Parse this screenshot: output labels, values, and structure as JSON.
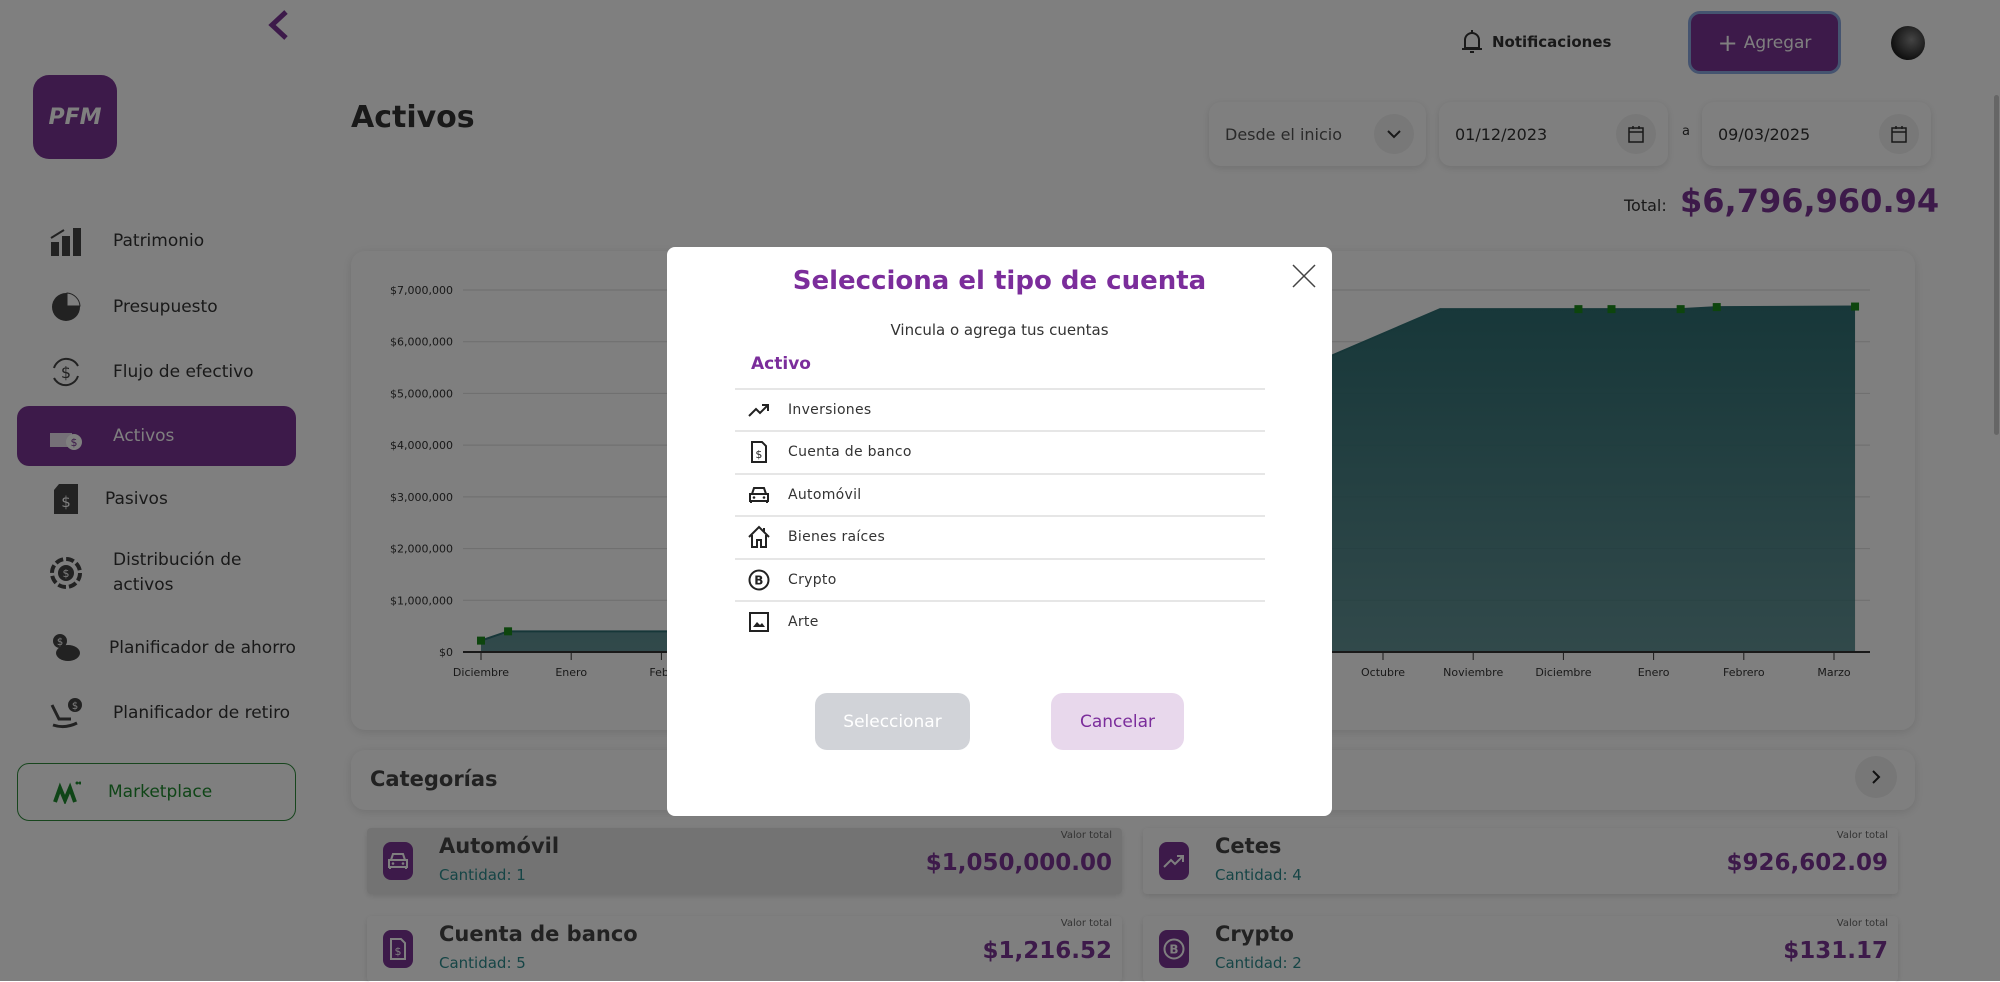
{
  "sidebar": {
    "logo": "PFM",
    "items": [
      {
        "label": "Patrimonio",
        "icon": "bar-chart-icon"
      },
      {
        "label": "Presupuesto",
        "icon": "pie-chart-icon"
      },
      {
        "label": "Flujo de efectivo",
        "icon": "cash-flow-icon"
      },
      {
        "label": "Activos",
        "icon": "assets-icon",
        "active": true
      },
      {
        "label": "Pasivos",
        "icon": "invoice-icon"
      },
      {
        "label": "Distribución de activos",
        "icon": "coin-distribution-icon"
      },
      {
        "label": "Planificador de ahorro",
        "icon": "piggy-bank-icon"
      },
      {
        "label": "Planificador de retiro",
        "icon": "rocking-chair-icon"
      }
    ],
    "marketplace": "Marketplace"
  },
  "header": {
    "notifications": "Notificaciones",
    "add": "Agregar"
  },
  "page": {
    "title": "Activos",
    "range_select": "Desde el inicio",
    "date_from": "01/12/2023",
    "date_sep": "a",
    "date_to": "09/03/2025",
    "total_label": "Total:",
    "total_value": "$6,796,960.94"
  },
  "colors": {
    "accent": "#7a3494",
    "teal": "#2c8a8c",
    "area": "#2f6f73",
    "marker": "#1a8a1a"
  },
  "chart_data": {
    "type": "area",
    "ylim": [
      0,
      7000000
    ],
    "yticks": [
      "$0",
      "$1,000,000",
      "$2,000,000",
      "$3,000,000",
      "$4,000,000",
      "$5,000,000",
      "$6,000,000",
      "$7,000,000"
    ],
    "xlabels": [
      {
        "date": "2023-12",
        "label": "Diciembre"
      },
      {
        "date": "2024-01",
        "label": "Enero"
      },
      {
        "date": "2024-02",
        "label": "Febr"
      },
      {
        "date": "2024-10",
        "label": "Octubre"
      },
      {
        "date": "2024-11",
        "label": "Noviembre"
      },
      {
        "date": "2024-12",
        "label": "Diciembre"
      },
      {
        "date": "2025-01",
        "label": "Enero"
      },
      {
        "date": "2025-02",
        "label": "Febrero"
      },
      {
        "date": "2025-03",
        "label": "Marzo"
      }
    ],
    "grid": true,
    "points": [
      {
        "x": "2023-12-01",
        "y": 220000,
        "marker": true
      },
      {
        "x": "2023-12-10",
        "y": 400000,
        "marker": true
      },
      {
        "x": "2024-02-10",
        "y": 400000,
        "marker": false
      },
      {
        "x": "2024-10-20",
        "y": 6630000,
        "marker": false
      },
      {
        "x": "2024-12-06",
        "y": 6630000,
        "marker": true
      },
      {
        "x": "2024-12-17",
        "y": 6630000,
        "marker": true
      },
      {
        "x": "2025-01-10",
        "y": 6630000,
        "marker": true
      },
      {
        "x": "2025-01-22",
        "y": 6670000,
        "marker": true
      },
      {
        "x": "2025-03-08",
        "y": 6680000,
        "marker": true
      }
    ]
  },
  "categories": {
    "title": "Categorías",
    "value_label": "Valor total",
    "items": [
      {
        "name": "Automóvil",
        "qty": "Cantidad: 1",
        "value": "$1,050,000.00",
        "icon": "car-icon"
      },
      {
        "name": "Cetes",
        "qty": "Cantidad: 4",
        "value": "$926,602.09",
        "icon": "cetes-icon"
      },
      {
        "name": "Cuenta de banco",
        "qty": "Cantidad: 5",
        "value": "$1,216.52",
        "icon": "bank-doc-icon"
      },
      {
        "name": "Crypto",
        "qty": "Cantidad: 2",
        "value": "$131.17",
        "icon": "bitcoin-icon"
      }
    ]
  },
  "modal": {
    "title": "Selecciona el tipo de cuenta",
    "subtitle": "Vincula o agrega tus cuentas",
    "section": "Activo",
    "options": [
      {
        "label": "Inversiones",
        "icon": "trending-up-icon"
      },
      {
        "label": "Cuenta de banco",
        "icon": "bank-doc-icon"
      },
      {
        "label": "Automóvil",
        "icon": "car-icon"
      },
      {
        "label": "Bienes raíces",
        "icon": "house-icon"
      },
      {
        "label": "Crypto",
        "icon": "bitcoin-icon"
      },
      {
        "label": "Arte",
        "icon": "image-icon"
      }
    ],
    "select": "Seleccionar",
    "cancel": "Cancelar"
  }
}
